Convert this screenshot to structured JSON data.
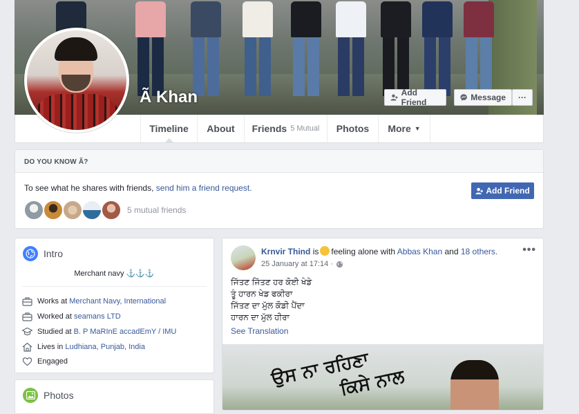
{
  "profile": {
    "name": "Ã Khan",
    "add_friend_label": "Add Friend",
    "message_label": "Message",
    "more_dots": "···"
  },
  "nav": {
    "tabs": [
      {
        "label": "Timeline"
      },
      {
        "label": "About"
      },
      {
        "label": "Friends",
        "sub": "5 Mutual"
      },
      {
        "label": "Photos"
      },
      {
        "label": "More",
        "caret": "▼"
      }
    ]
  },
  "know_card": {
    "heading": "DO YOU KNOW Ã?",
    "text_prefix": "To see what he shares with friends, ",
    "text_link": "send him a friend request.",
    "add_friend_label": "Add Friend",
    "mutual_text": "5 mutual friends",
    "mutual_colors": [
      "#8f9aa3",
      "#c68a3a",
      "#c7a88a",
      "#2f6d9b",
      "#a25a46"
    ]
  },
  "intro": {
    "title": "Intro",
    "bio": "Merchant navy ⚓⚓⚓",
    "items": [
      {
        "icon": "briefcase-icon",
        "prefix": "Works at ",
        "link": "Merchant Navy, International"
      },
      {
        "icon": "briefcase-icon",
        "prefix": "Worked at ",
        "link": "seamans LTD"
      },
      {
        "icon": "graduation-cap-icon",
        "prefix": "Studied at ",
        "link": "B. P MaRInE accadEmY / IMU"
      },
      {
        "icon": "home-icon",
        "prefix": "Lives in ",
        "link": "Ludhiana, Punjab, India"
      },
      {
        "icon": "heart-icon",
        "prefix": "Engaged",
        "link": ""
      }
    ]
  },
  "photos_card": {
    "title": "Photos"
  },
  "post": {
    "author": "Krnvir Thind",
    "is": "is",
    "feeling": "feeling alone with",
    "with_name": "Abbas Khan",
    "and": "and",
    "others": "18 others.",
    "time": "25 January at 17:14 ·",
    "dots": "•••",
    "text": "ਜਿੱਤਣ ਜਿੱਤਣ ਹਰ ਕੋਈ ਖੇਡੇ\nਤੂੰ ਹਾਰਨ ਖੇਡ ਫਕੀਰਾ\nਜਿੱਤਣ ਦਾ ਮੁੱਲ ਕੌਡੀ ਪੈਂਦਾ\nਹਾਰਨ ਦਾ ਮੁੱਲ ਹੀਰਾ",
    "see_translation": "See Translation"
  }
}
